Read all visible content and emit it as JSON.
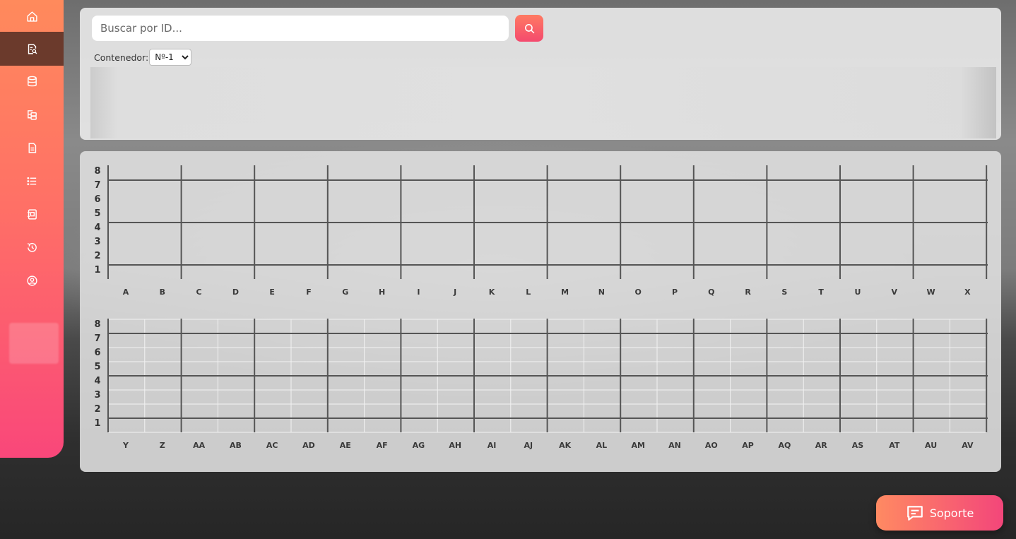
{
  "sidebar": {
    "items": [
      {
        "icon": "home-icon",
        "active": false
      },
      {
        "icon": "search-document-icon",
        "active": true
      },
      {
        "icon": "database-icon",
        "active": false
      },
      {
        "icon": "tree-list-icon",
        "active": false
      },
      {
        "icon": "file-icon",
        "active": false
      },
      {
        "icon": "list-icon",
        "active": false
      },
      {
        "icon": "notebook-icon",
        "active": false
      },
      {
        "icon": "history-icon",
        "active": false
      },
      {
        "icon": "user-circle-icon",
        "active": false
      }
    ],
    "colors": {
      "top": "#ff8a5c",
      "bottom": "#f9477a",
      "active": "#6b3a2c"
    }
  },
  "search": {
    "placeholder": "Buscar por ID...",
    "value": "",
    "button_icon": "search-icon"
  },
  "container": {
    "label": "Contenedor:",
    "selected": "Nº-1"
  },
  "grid1": {
    "rows": [
      "8",
      "7",
      "6",
      "5",
      "4",
      "3",
      "2",
      "1"
    ],
    "columns": [
      "A",
      "B",
      "C",
      "D",
      "E",
      "F",
      "G",
      "H",
      "I",
      "J",
      "K",
      "L",
      "M",
      "N",
      "O",
      "P",
      "Q",
      "R",
      "S",
      "T",
      "U",
      "V",
      "W",
      "X"
    ]
  },
  "grid2": {
    "rows": [
      "8",
      "7",
      "6",
      "5",
      "4",
      "3",
      "2",
      "1"
    ],
    "columns": [
      "Y",
      "Z",
      "AA",
      "AB",
      "AC",
      "AD",
      "AE",
      "AF",
      "AG",
      "AH",
      "AI",
      "AJ",
      "AK",
      "AL",
      "AM",
      "AN",
      "AO",
      "AP",
      "AQ",
      "AR",
      "AS",
      "AT",
      "AU",
      "AV"
    ]
  },
  "support": {
    "label": "Soporte",
    "icon": "chat-icon",
    "color_start": "#ff8a62",
    "color_end": "#f3467a"
  }
}
